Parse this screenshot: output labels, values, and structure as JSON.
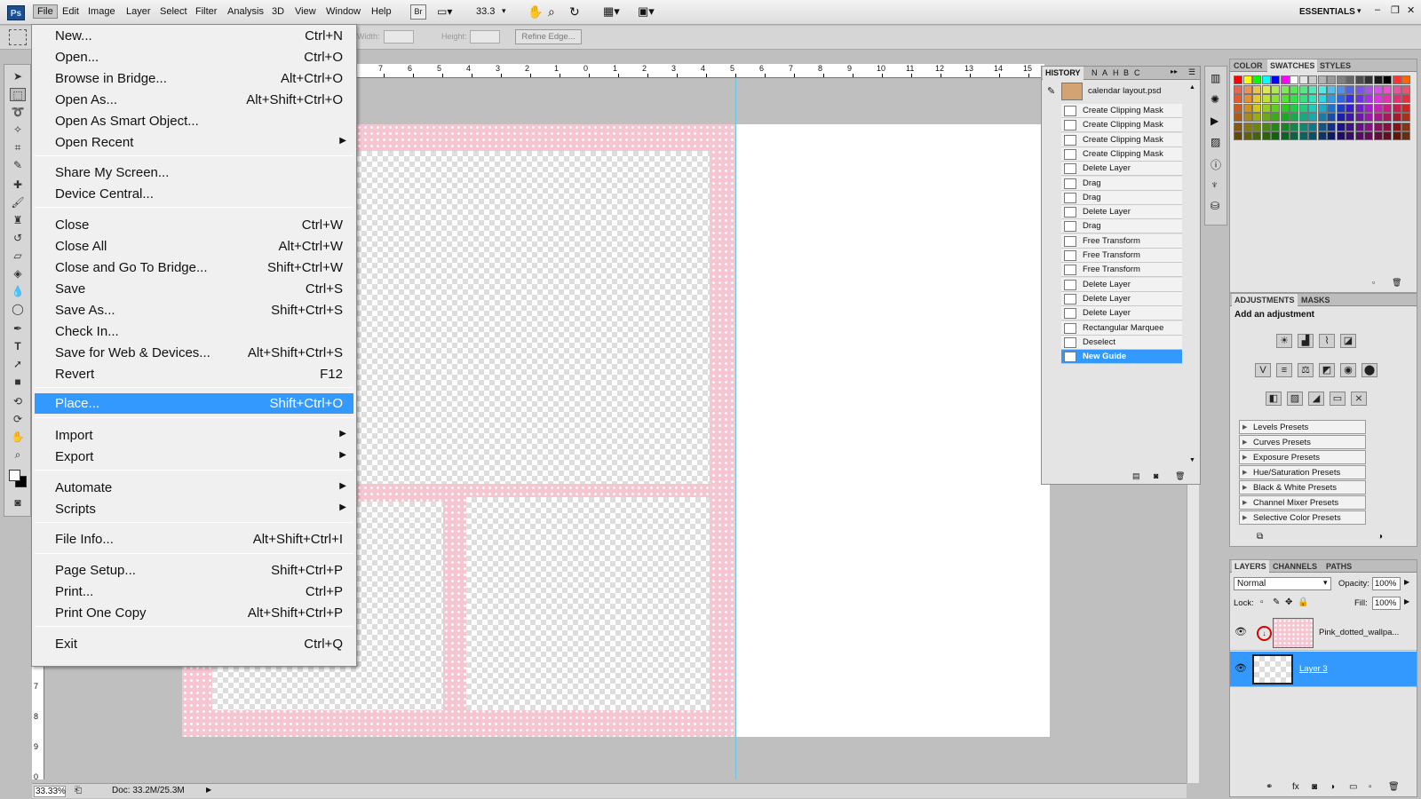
{
  "menubar": {
    "logo": "Ps",
    "items": [
      "File",
      "Edit",
      "Image",
      "Layer",
      "Select",
      "Filter",
      "Analysis",
      "3D",
      "View",
      "Window",
      "Help"
    ],
    "bridge_icon": "Br",
    "zoom": "33.3",
    "workspace": "ESSENTIALS"
  },
  "options": {
    "width_label": "Width:",
    "height_label": "Height:",
    "refine_edge": "Refine Edge..."
  },
  "file_menu": {
    "items": [
      {
        "label": "New...",
        "shortcut": "Ctrl+N"
      },
      {
        "label": "Open...",
        "shortcut": "Ctrl+O"
      },
      {
        "label": "Browse in Bridge...",
        "shortcut": "Alt+Ctrl+O"
      },
      {
        "label": "Open As...",
        "shortcut": "Alt+Shift+Ctrl+O"
      },
      {
        "label": "Open As Smart Object...",
        "shortcut": ""
      },
      {
        "label": "Open Recent",
        "shortcut": ""
      },
      {
        "label": "Share My Screen...",
        "shortcut": ""
      },
      {
        "label": "Device Central...",
        "shortcut": ""
      },
      {
        "label": "Close",
        "shortcut": "Ctrl+W"
      },
      {
        "label": "Close All",
        "shortcut": "Alt+Ctrl+W"
      },
      {
        "label": "Close and Go To Bridge...",
        "shortcut": "Shift+Ctrl+W"
      },
      {
        "label": "Save",
        "shortcut": "Ctrl+S"
      },
      {
        "label": "Save As...",
        "shortcut": "Shift+Ctrl+S"
      },
      {
        "label": "Check In...",
        "shortcut": ""
      },
      {
        "label": "Save for Web & Devices...",
        "shortcut": "Alt+Shift+Ctrl+S"
      },
      {
        "label": "Revert",
        "shortcut": "F12"
      },
      {
        "label": "Place...",
        "shortcut": "Shift+Ctrl+O"
      },
      {
        "label": "Import",
        "shortcut": ""
      },
      {
        "label": "Export",
        "shortcut": ""
      },
      {
        "label": "Automate",
        "shortcut": ""
      },
      {
        "label": "Scripts",
        "shortcut": ""
      },
      {
        "label": "File Info...",
        "shortcut": "Alt+Shift+Ctrl+I"
      },
      {
        "label": "Page Setup...",
        "shortcut": "Shift+Ctrl+P"
      },
      {
        "label": "Print...",
        "shortcut": "Ctrl+P"
      },
      {
        "label": "Print One Copy",
        "shortcut": "Alt+Shift+Ctrl+P"
      },
      {
        "label": "Exit",
        "shortcut": "Ctrl+Q"
      }
    ]
  },
  "ruler": {
    "top_ticks": [
      "7",
      "6",
      "5",
      "4",
      "3",
      "2",
      "1",
      "0",
      "1",
      "2",
      "3",
      "4",
      "5",
      "6",
      "7",
      "8",
      "9",
      "10",
      "11",
      "12",
      "13",
      "14",
      "15"
    ],
    "left_ticks": [
      "7",
      "8",
      "9",
      "0"
    ]
  },
  "history": {
    "tabs": [
      "HISTORY",
      "N",
      "A",
      "H",
      "B",
      "C"
    ],
    "snapshot": "calendar layout.psd",
    "steps": [
      "Create Clipping Mask",
      "Create Clipping Mask",
      "Create Clipping Mask",
      "Create Clipping Mask",
      "Delete Layer",
      "Drag",
      "Drag",
      "Delete Layer",
      "Drag",
      "Free Transform",
      "Free Transform",
      "Free Transform",
      "Delete Layer",
      "Delete Layer",
      "Delete Layer",
      "Rectangular Marquee",
      "Deselect",
      "New Guide"
    ]
  },
  "swatches": {
    "tabs": [
      "COLOR",
      "SWATCHES",
      "STYLES"
    ],
    "colors": [
      "#ff0000",
      "#ffff00",
      "#00ff00",
      "#00ffff",
      "#0000ff",
      "#ff00ff",
      "#ffffff",
      "#e6e6e6",
      "#cccccc",
      "#b3b3b3",
      "#999999",
      "#808080",
      "#666666",
      "#4d4d4d",
      "#333333",
      "#1a1a1a",
      "#000000",
      "#ff3333",
      "#ff6600"
    ]
  },
  "adjustments": {
    "tabs": [
      "ADJUSTMENTS",
      "MASKS"
    ],
    "heading": "Add an adjustment",
    "presets": [
      "Levels Presets",
      "Curves Presets",
      "Exposure Presets",
      "Hue/Saturation Presets",
      "Black & White Presets",
      "Channel Mixer Presets",
      "Selective Color Presets"
    ]
  },
  "layers": {
    "tabs": [
      "LAYERS",
      "CHANNELS",
      "PATHS"
    ],
    "blend_mode": "Normal",
    "opacity_label": "Opacity:",
    "opacity": "100%",
    "lock_label": "Lock:",
    "fill_label": "Fill:",
    "fill": "100%",
    "items": [
      "Pink_dotted_wallpa...",
      "Layer 3"
    ]
  },
  "status": {
    "zoom": "33.33%",
    "doc": "Doc: 33.2M/25.3M"
  }
}
